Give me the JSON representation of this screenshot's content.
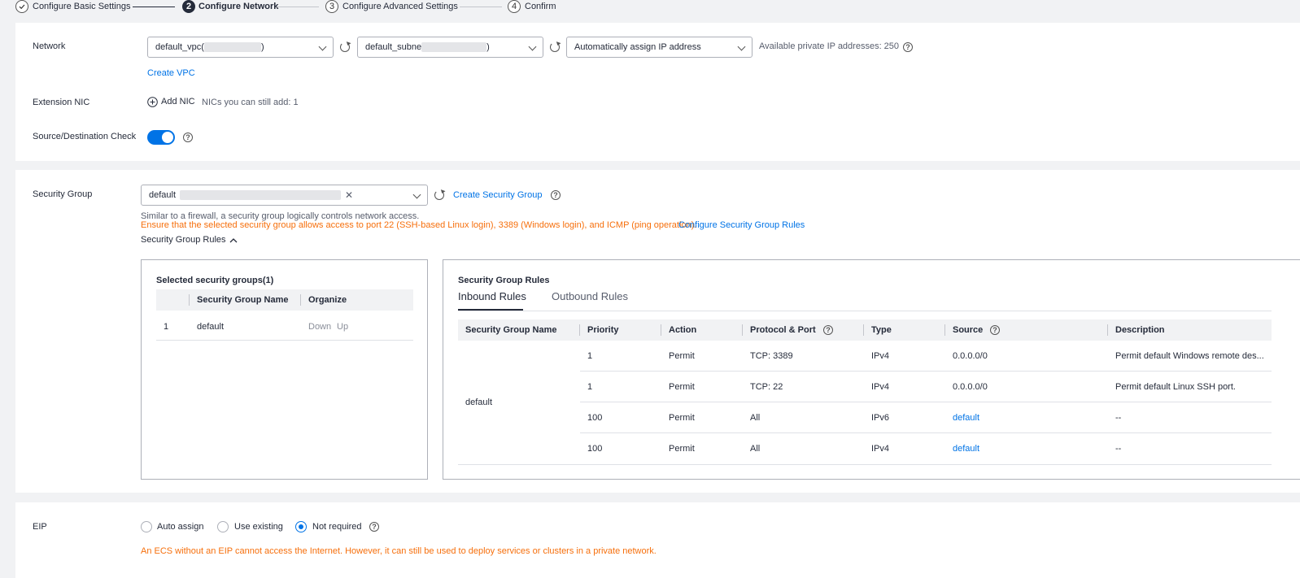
{
  "steps": [
    {
      "number": "",
      "label": "Configure Basic Settings",
      "state": "done"
    },
    {
      "number": "2",
      "label": "Configure Network",
      "state": "active"
    },
    {
      "number": "3",
      "label": "Configure Advanced Settings",
      "state": "pending"
    },
    {
      "number": "4",
      "label": "Confirm",
      "state": "pending"
    }
  ],
  "network": {
    "label": "Network",
    "vpc_value": "default_vpc(",
    "vpc_suffix": ")",
    "subnet_value": "default_subne",
    "subnet_suffix": ")",
    "ip_mode_value": "Automatically assign IP address",
    "available_ips_text": "Available private IP addresses: 250",
    "create_vpc_link": "Create VPC"
  },
  "extension_nic": {
    "label": "Extension NIC",
    "add_button": "Add NIC",
    "remaining_text": "NICs you can still add: 1"
  },
  "source_dest_check": {
    "label": "Source/Destination Check",
    "enabled": true
  },
  "security_group": {
    "label": "Security Group",
    "selected_value": "default",
    "create_link": "Create Security Group",
    "hint": "Similar to a firewall, a security group logically controls network access.",
    "warning": "Ensure that the selected security group allows access to port 22 (SSH-based Linux login), 3389 (Windows login), and ICMP (ping operation).",
    "configure_rules_link": "Configure Security Group Rules",
    "rules_toggle_label": "Security Group Rules",
    "selected_panel": {
      "title": "Selected security groups(1)",
      "columns": [
        "Security Group Name",
        "Organize"
      ],
      "rows": [
        {
          "index": "1",
          "name": "default",
          "down": "Down",
          "up": "Up"
        }
      ]
    },
    "rules_panel": {
      "title": "Security Group Rules",
      "tabs": [
        "Inbound Rules",
        "Outbound Rules"
      ],
      "active_tab": "Inbound Rules",
      "columns": [
        "Security Group Name",
        "Priority",
        "Action",
        "Protocol & Port",
        "Type",
        "Source",
        "Description"
      ],
      "group_name": "default",
      "rows": [
        {
          "priority": "1",
          "action": "Permit",
          "protocol_port": "TCP: 3389",
          "type": "IPv4",
          "source": "0.0.0.0/0",
          "source_is_link": false,
          "description": "Permit default Windows remote des..."
        },
        {
          "priority": "1",
          "action": "Permit",
          "protocol_port": "TCP: 22",
          "type": "IPv4",
          "source": "0.0.0.0/0",
          "source_is_link": false,
          "description": "Permit default Linux SSH port."
        },
        {
          "priority": "100",
          "action": "Permit",
          "protocol_port": "All",
          "type": "IPv6",
          "source": "default",
          "source_is_link": true,
          "description": "--"
        },
        {
          "priority": "100",
          "action": "Permit",
          "protocol_port": "All",
          "type": "IPv4",
          "source": "default",
          "source_is_link": true,
          "description": "--"
        }
      ]
    }
  },
  "eip": {
    "label": "EIP",
    "options": [
      "Auto assign",
      "Use existing",
      "Not required"
    ],
    "selected": "Not required",
    "warning": "An ECS without an EIP cannot access the Internet. However, it can still be used to deploy services or clusters in a private network."
  },
  "colors": {
    "accent": "#0073e6",
    "warning": "#f66f0c",
    "text": "#252b3a"
  }
}
